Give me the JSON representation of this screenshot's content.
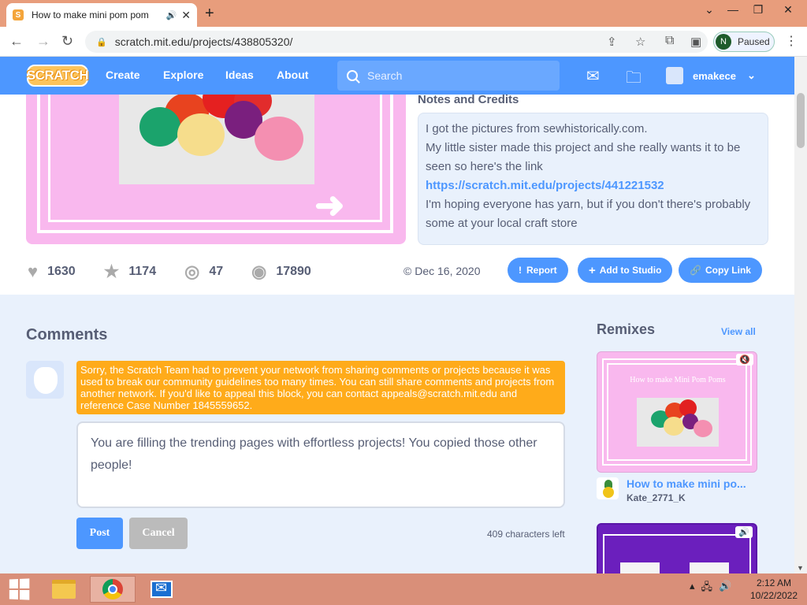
{
  "browser": {
    "tab_title": "How to make mini pom pom",
    "favicon": "S",
    "url": "scratch.mit.edu/projects/438805320/",
    "profile_initial": "N",
    "profile_status": "Paused"
  },
  "nav": {
    "logo": "SCRATCH",
    "links": [
      "Create",
      "Explore",
      "Ideas",
      "About"
    ],
    "search_placeholder": "Search",
    "username": "emakece"
  },
  "notes": {
    "title": "Notes and Credits",
    "line1": "I got the pictures from sewhistorically.com.",
    "line2": "My little sister made this project and she really wants it to be seen so here's the link",
    "link": "https://scratch.mit.edu/projects/441221532",
    "line3": "I'm hoping everyone has yarn, but if you don't there's probably some at your local craft store"
  },
  "stats": {
    "loves": "1630",
    "favorites": "1174",
    "remixes": "47",
    "views": "17890",
    "date": "© Dec 16, 2020"
  },
  "actions": {
    "report": "Report",
    "add_to_studio": "Add to Studio",
    "copy_link": "Copy Link"
  },
  "comments": {
    "title": "Comments",
    "warning": "Sorry, the Scratch Team had to prevent your network from sharing comments or projects because it was used to break our community guidelines too many times. You can still share comments and projects from another network. If you'd like to appeal this block, you can contact appeals@scratch.mit.edu and reference Case Number 1845559652.",
    "input_text": "You are filling the trending pages with effortless projects! You copied those other people!",
    "post_label": "Post",
    "cancel_label": "Cancel",
    "chars_left": "409 characters left"
  },
  "remixes": {
    "title": "Remixes",
    "view_all": "View all",
    "thumb_title": "How to make Mini Pom Poms",
    "items": [
      {
        "name": "How to make mini po...",
        "author": "Kate_2771_K"
      }
    ]
  },
  "taskbar": {
    "time": "2:12 AM",
    "date": "10/22/2022"
  }
}
